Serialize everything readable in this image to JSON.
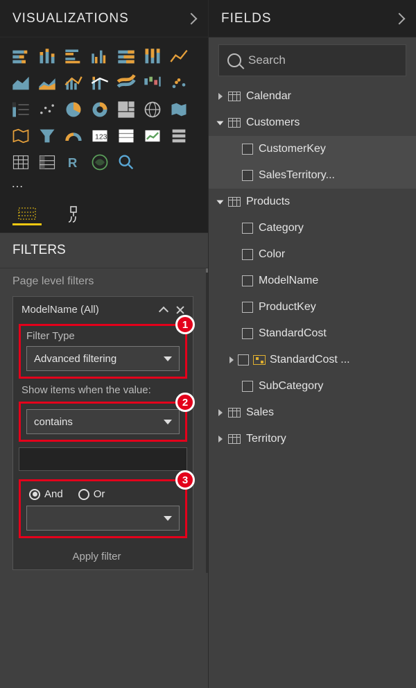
{
  "visualizations": {
    "header": "VISUALIZATIONS",
    "more": "…",
    "icons": [
      "stacked-bar",
      "stacked-column",
      "clustered-bar",
      "clustered-column",
      "100-stacked-bar",
      "100-stacked-column",
      "line",
      "area",
      "stacked-area",
      "line-clustered",
      "line-stacked",
      "ribbon",
      "waterfall",
      "scatter",
      "pie",
      "donut",
      "treemap",
      "map",
      "filled-map",
      "funnel",
      "gauge",
      "card",
      "multi-card",
      "kpi",
      "slicer",
      "table",
      "matrix",
      "r-visual",
      "python-visual",
      "arcgis",
      "search-visual"
    ]
  },
  "filters": {
    "header": "FILTERS",
    "page_level_label": "Page level filters",
    "card": {
      "title": "ModelName (All)",
      "filter_type_label": "Filter Type",
      "filter_type_value": "Advanced filtering",
      "show_items_label": "Show items when the value:",
      "condition1_value": "contains",
      "logic_and": "And",
      "logic_or": "Or",
      "condition2_value": "",
      "apply": "Apply filter"
    },
    "callouts": {
      "one": "1",
      "two": "2",
      "three": "3"
    }
  },
  "fields": {
    "header": "FIELDS",
    "search_placeholder": "Search",
    "tables": [
      {
        "name": "Calendar",
        "expanded": false,
        "fields": []
      },
      {
        "name": "Customers",
        "expanded": true,
        "fields": [
          {
            "name": "CustomerKey",
            "selected": true
          },
          {
            "name": "SalesTerritory...",
            "selected": true
          }
        ]
      },
      {
        "name": "Products",
        "expanded": true,
        "fields": [
          {
            "name": "Category"
          },
          {
            "name": "Color"
          },
          {
            "name": "ModelName"
          },
          {
            "name": "ProductKey"
          },
          {
            "name": "StandardCost"
          },
          {
            "name": "StandardCost ...",
            "hierarchy": true,
            "expandable": true
          },
          {
            "name": "SubCategory"
          }
        ]
      },
      {
        "name": "Sales",
        "expanded": false,
        "fields": []
      },
      {
        "name": "Territory",
        "expanded": false,
        "fields": []
      }
    ]
  }
}
